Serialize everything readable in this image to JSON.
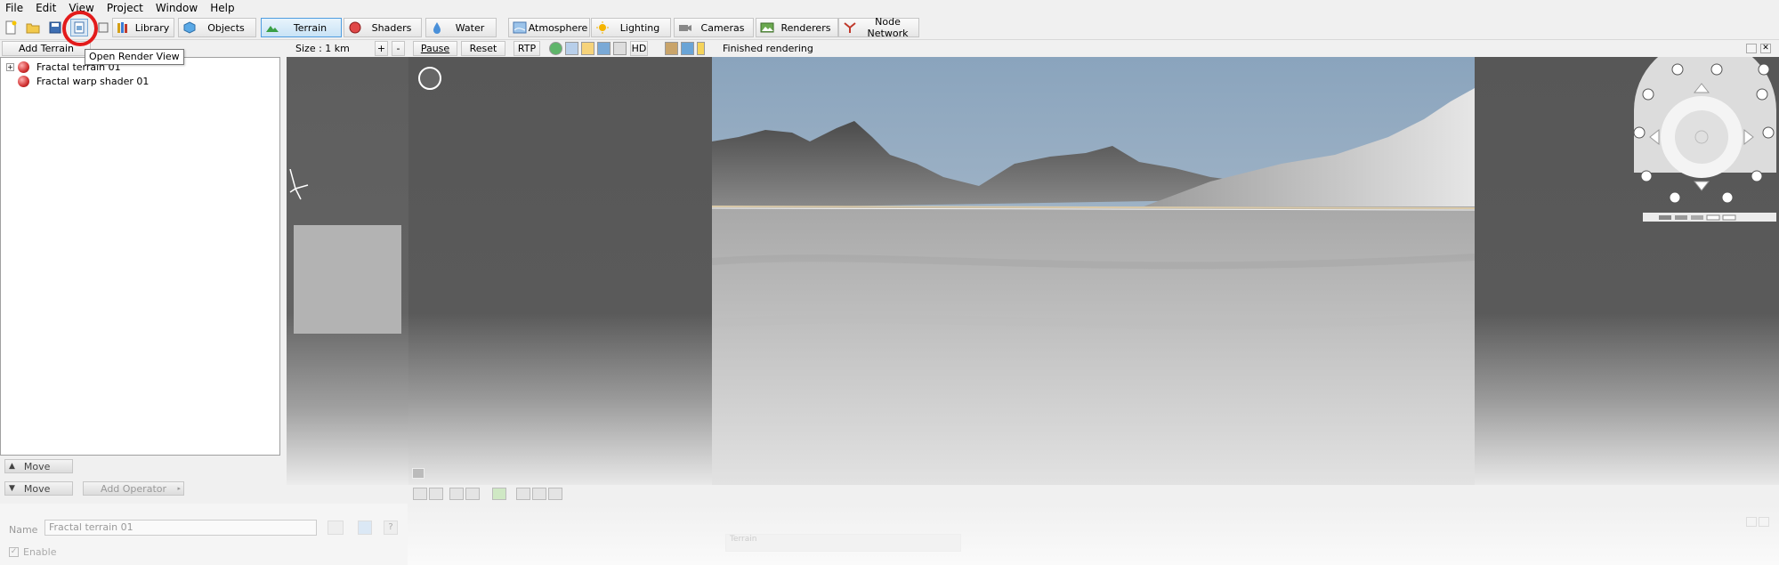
{
  "menu": [
    "File",
    "Edit",
    "View",
    "Project",
    "Window",
    "Help"
  ],
  "toolbar": {
    "tabs": [
      {
        "label": "Library"
      },
      {
        "label": "Objects"
      },
      {
        "label": "Terrain"
      },
      {
        "label": "Shaders"
      },
      {
        "label": "Water"
      },
      {
        "label": "Atmosphere"
      },
      {
        "label": "Lighting"
      },
      {
        "label": "Cameras"
      },
      {
        "label": "Renderers"
      },
      {
        "label": "Node Network"
      }
    ],
    "active_tab": "Terrain",
    "tooltip": "Open Render View"
  },
  "left_panel": {
    "add_button": "Add Terrain",
    "tree": [
      {
        "label": "Fractal terrain 01",
        "expandable": true
      },
      {
        "label": "Fractal warp shader 01",
        "expandable": false
      }
    ],
    "move_up": "Move",
    "move_down": "Move",
    "add_operator": "Add Operator"
  },
  "properties": {
    "name_label": "Name",
    "name_value": "Fractal terrain 01",
    "enable_label": "Enable",
    "panel_title": "Terrain"
  },
  "view_toolbar": {
    "size": "Size : 1 km",
    "plus": "+",
    "minus": "-",
    "pause": "Pause",
    "reset": "Reset",
    "rtp": "RTP",
    "hd": "HD",
    "status": "Finished rendering"
  },
  "colors": {
    "accent": "#4f9de0",
    "highlight": "#e31b1b",
    "sky": "#8aa4bd"
  }
}
